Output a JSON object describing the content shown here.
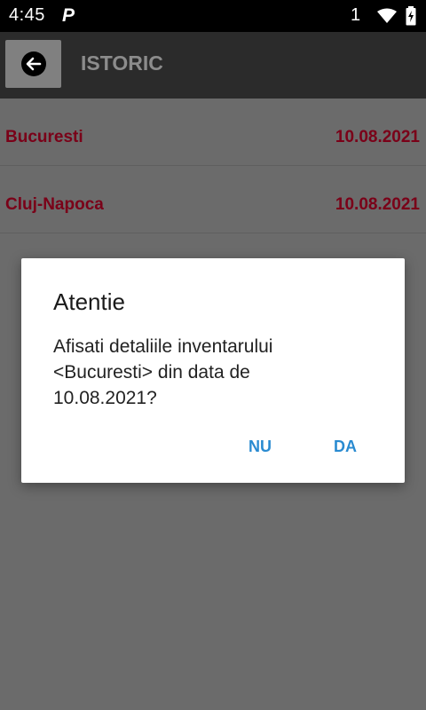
{
  "status_bar": {
    "time": "4:45",
    "app_indicator": "P",
    "sim_count": "1",
    "icons": [
      "wifi-icon",
      "battery-charging-icon"
    ]
  },
  "app_bar": {
    "title": "ISTORIC",
    "back_icon": "arrow-left-icon"
  },
  "history_list": [
    {
      "city": "Bucuresti",
      "date": "10.08.2021"
    },
    {
      "city": "Cluj-Napoca",
      "date": "10.08.2021"
    }
  ],
  "dialog": {
    "title": "Atentie",
    "message": "Afisati detaliile inventarului <Bucuresti> din data de 10.08.2021?",
    "negative_label": "NU",
    "positive_label": "DA"
  },
  "colors": {
    "accent": "#2a8bd1",
    "list_text": "#7a0018",
    "app_bar": "#2b2b2b",
    "scrim_background": "#6b6b6b"
  }
}
